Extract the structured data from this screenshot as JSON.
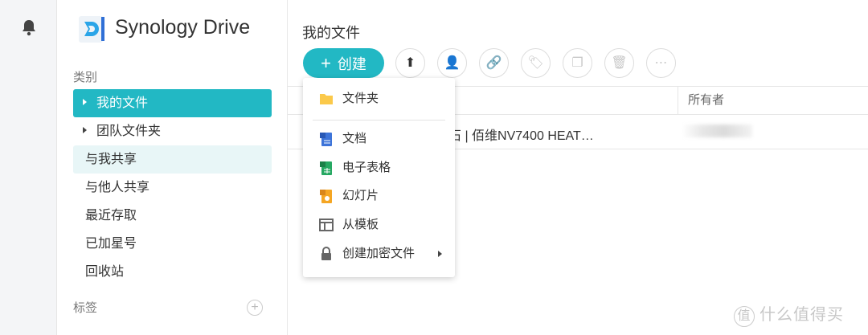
{
  "app": {
    "name": "Synology Drive"
  },
  "sidebar": {
    "category_label": "类别",
    "items": [
      {
        "label": "我的文件"
      },
      {
        "label": "团队文件夹"
      },
      {
        "label": "与我共享"
      },
      {
        "label": "与他人共享"
      },
      {
        "label": "最近存取"
      },
      {
        "label": "已加星号"
      },
      {
        "label": "回收站"
      }
    ],
    "tags_label": "标签"
  },
  "main": {
    "title": "我的文件",
    "create_label": "创建",
    "owner_header": "所有者",
    "file_name": "彩灵石 | 佰维NV7400 HEAT…"
  },
  "menu": {
    "items": [
      {
        "label": "文件夹"
      },
      {
        "label": "文档"
      },
      {
        "label": "电子表格"
      },
      {
        "label": "幻灯片"
      },
      {
        "label": "从模板"
      },
      {
        "label": "创建加密文件"
      }
    ]
  },
  "watermark": {
    "text": "什么值得买",
    "badge": "值"
  },
  "colors": {
    "accent": "#22b8c4"
  }
}
